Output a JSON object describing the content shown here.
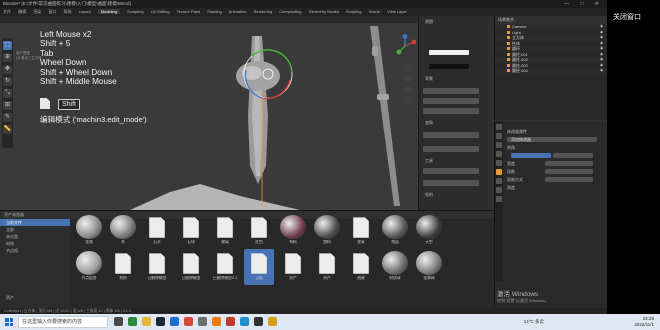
{
  "window": {
    "title": "Blender* [E:\\文件\\常见曲面练习\\建模\\入门\\模型\\曲面\\建模\\Blend]",
    "controls": [
      "—",
      "□",
      "✕"
    ]
  },
  "menubar": {
    "items": [
      "文件",
      "编辑",
      "渲染",
      "窗口",
      "帮助"
    ],
    "workspaces": [
      "Layout",
      "Modeling",
      "Sculpting",
      "UV Editing",
      "Texture Paint",
      "Shading",
      "Animation",
      "Rendering",
      "Compositing",
      "Geometry Nodes",
      "Scripting"
    ],
    "active_workspace": "Modeling",
    "scene": "Scene",
    "view_layer": "View Layer"
  },
  "viewport": {
    "key_overlay": [
      "Left Mouse x2",
      "Shift + 5",
      "Tab",
      "Wheel Down",
      "Shift + Wheel Down",
      "Shift + Middle Mouse"
    ],
    "shift_key": "Shift",
    "mode_text": "编辑模式 ('machin3.edit_mode')",
    "view_info": "用户透视",
    "collection_info": "(1) 集合 | 立方体"
  },
  "toolbar": {
    "tools": [
      {
        "icon": "select-box-icon",
        "glyph": "⬚",
        "active": true
      },
      {
        "icon": "cursor-icon",
        "glyph": "⊕",
        "active": false
      },
      {
        "icon": "move-icon",
        "glyph": "✥",
        "active": false
      },
      {
        "icon": "rotate-icon",
        "glyph": "↻",
        "active": false
      },
      {
        "icon": "scale-icon",
        "glyph": "⤡",
        "active": false
      },
      {
        "icon": "transform-icon",
        "glyph": "⊞",
        "active": false
      },
      {
        "icon": "annotate-icon",
        "glyph": "✎",
        "active": false
      },
      {
        "icon": "measure-icon",
        "glyph": "📏",
        "active": false
      }
    ]
  },
  "npanel": {
    "labels": [
      "背景",
      "视图",
      "变换",
      "项目",
      "工具",
      "显示",
      "选项"
    ],
    "view_label": "视图",
    "snap_label": "吸附"
  },
  "outliner": {
    "header": "场景集合",
    "rows": [
      "Camera",
      "Light",
      "立方体",
      "柱体",
      "圆环",
      "圆柱.001",
      "圆柱.002",
      "圆柱.003",
      "圆柱.004"
    ]
  },
  "properties": {
    "section": "修改器属性",
    "add_modifier": "添加修改器",
    "mod_name": "倒角",
    "opts": [
      "宽度",
      "段数",
      "限制方式",
      "角度"
    ]
  },
  "assets": {
    "header": "资产浏览器",
    "library": "当前文件",
    "side_items": [
      "全部",
      "未分类",
      "材质",
      "节点组"
    ],
    "row1": [
      {
        "cap": "金属",
        "kind": "sphere",
        "color": "#888"
      },
      {
        "cap": "木",
        "kind": "sphere",
        "color": "#777"
      },
      {
        "cap": "石头",
        "kind": "doc"
      },
      {
        "cap": "石块",
        "kind": "doc"
      },
      {
        "cap": "玻璃",
        "kind": "doc"
      },
      {
        "cap": "红色",
        "kind": "doc"
      },
      {
        "cap": "布料",
        "kind": "sphere",
        "color": "#6d3a4a"
      },
      {
        "cap": "塑料",
        "kind": "sphere",
        "color": "#4a4a4a"
      },
      {
        "cap": "皮革",
        "kind": "doc"
      },
      {
        "cap": "地面",
        "kind": "sphere",
        "color": "#555"
      },
      {
        "cap": "天空",
        "kind": "sphere",
        "color": "#3d3d3d"
      }
    ],
    "row2": [
      {
        "cap": "节点组合",
        "kind": "sphere",
        "color": "#9a9a9a"
      },
      {
        "cap": "材质",
        "kind": "doc"
      },
      {
        "cap": "已删除模型",
        "kind": "doc"
      },
      {
        "cap": "已删除模型",
        "kind": "doc"
      },
      {
        "cap": "已删除模型2.1",
        "kind": "doc",
        "selected": false
      },
      {
        "cap": "当前",
        "kind": "doc",
        "selected": true
      },
      {
        "cap": "资产",
        "kind": "doc"
      },
      {
        "cap": "资产",
        "kind": "doc"
      },
      {
        "cap": "图案",
        "kind": "doc"
      },
      {
        "cap": "材质球",
        "kind": "sphere",
        "color": "#6a6a6a"
      },
      {
        "cap": "金属球",
        "kind": "sphere",
        "color": "#7a7a7a"
      }
    ],
    "footer": "资产"
  },
  "status": {
    "text": "Collection | 立方体 | 顶点 8/8 | 边 12/12 | 面 6/6 | 三角面 12 | 物体 1/5 | 3.1.0"
  },
  "watermark": {
    "title": "激活 Windows",
    "subtitle": "转到\"设置\"以激活 Windows。"
  },
  "side": {
    "restore": "关闭窗口"
  },
  "taskbar": {
    "search_placeholder": "在这里输入你要搜索的内容",
    "temperature": "14°C 多云",
    "time": "22:29",
    "date": "2022/11/1",
    "apps": [
      {
        "name": "task-view-icon",
        "color": "#4a4a4a"
      },
      {
        "name": "browser-icon",
        "color": "#2a8a3a"
      },
      {
        "name": "file-explorer-icon",
        "color": "#e8b53a"
      },
      {
        "name": "steam-icon",
        "color": "#1b2838"
      },
      {
        "name": "mail-icon",
        "color": "#1b6fd1"
      },
      {
        "name": "chrome-icon",
        "color": "#d84b37"
      },
      {
        "name": "settings-icon",
        "color": "#6d6d6d"
      },
      {
        "name": "blender-icon",
        "color": "#e87d0d"
      },
      {
        "name": "wps-icon",
        "color": "#c0392b"
      },
      {
        "name": "edge-icon",
        "color": "#1e8fd1"
      },
      {
        "name": "player-icon",
        "color": "#333"
      },
      {
        "name": "notes-icon",
        "color": "#d4a015"
      }
    ]
  },
  "colors": {
    "accent_blue": "#4772b3",
    "selection_orange": "#e59a3b",
    "gizmo_green": "#4bb33a",
    "gizmo_red": "#d0433a",
    "gizmo_blue": "#3a7ad0"
  }
}
